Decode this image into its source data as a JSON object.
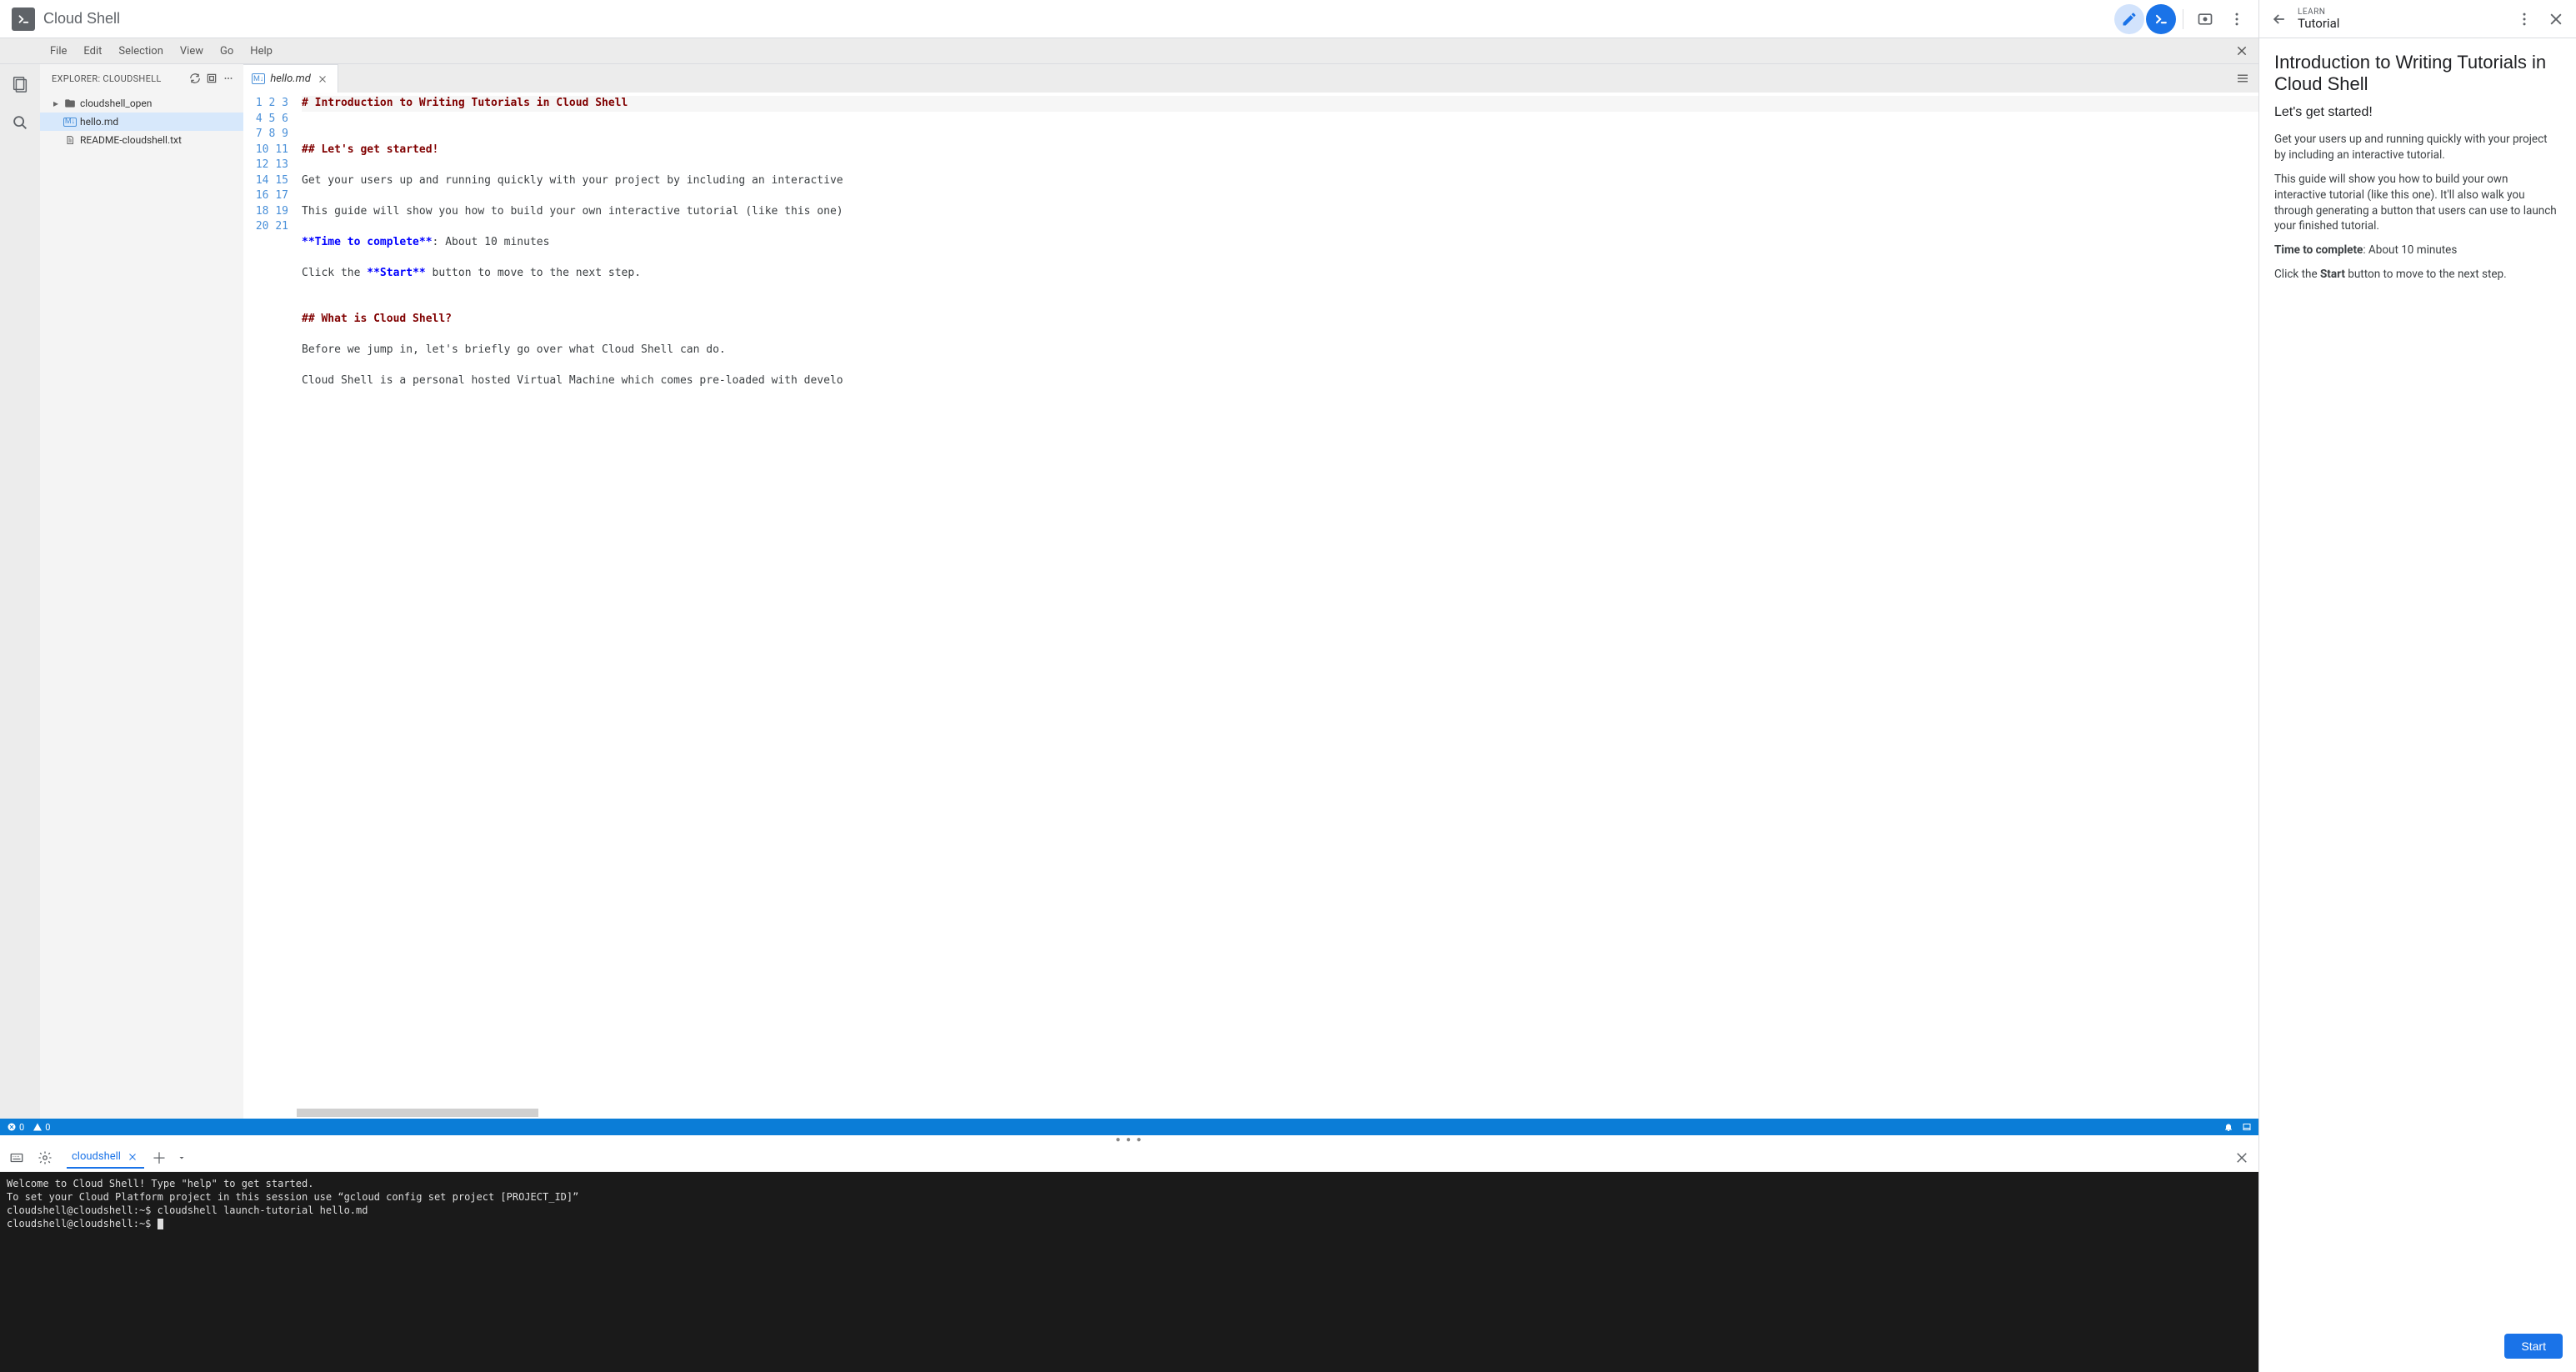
{
  "brand": "Cloud Shell",
  "menu": {
    "file": "File",
    "edit": "Edit",
    "selection": "Selection",
    "view": "View",
    "go": "Go",
    "help": "Help"
  },
  "explorer": {
    "title": "EXPLORER: CLOUDSHELL",
    "items": [
      {
        "name": "cloudshell_open",
        "type": "folder"
      },
      {
        "name": "hello.md",
        "type": "file",
        "selected": true
      },
      {
        "name": "README-cloudshell.txt",
        "type": "file"
      }
    ]
  },
  "editor_tab": {
    "label": "hello.md"
  },
  "code_lines": [
    {
      "tokens": [
        {
          "class": "tok-head",
          "text": "# Introduction to Writing Tutorials in Cloud Shell"
        }
      ],
      "hl": true
    },
    {
      "tokens": []
    },
    {
      "tokens": []
    },
    {
      "tokens": [
        {
          "class": "tok-head",
          "text": "## Let's get started!"
        }
      ]
    },
    {
      "tokens": []
    },
    {
      "tokens": [
        {
          "class": "",
          "text": "Get your users up and running quickly with your project by including an interactive"
        }
      ]
    },
    {
      "tokens": []
    },
    {
      "tokens": [
        {
          "class": "",
          "text": "This guide will show you how to build your own interactive tutorial (like this one)"
        }
      ]
    },
    {
      "tokens": []
    },
    {
      "tokens": [
        {
          "class": "tok-bold",
          "text": "**Time to complete**"
        },
        {
          "class": "",
          "text": ": About 10 minutes"
        }
      ]
    },
    {
      "tokens": []
    },
    {
      "tokens": [
        {
          "class": "",
          "text": "Click the "
        },
        {
          "class": "tok-bold",
          "text": "**Start**"
        },
        {
          "class": "",
          "text": " button to move to the next step."
        }
      ]
    },
    {
      "tokens": []
    },
    {
      "tokens": []
    },
    {
      "tokens": [
        {
          "class": "tok-head",
          "text": "## What is Cloud Shell?"
        }
      ]
    },
    {
      "tokens": []
    },
    {
      "tokens": [
        {
          "class": "",
          "text": "Before we jump in, let's briefly go over what Cloud Shell can do."
        }
      ]
    },
    {
      "tokens": []
    },
    {
      "tokens": [
        {
          "class": "",
          "text": "Cloud Shell is a personal hosted Virtual Machine which comes pre-loaded with develo"
        }
      ]
    },
    {
      "tokens": []
    }
  ],
  "statusbar": {
    "errors": "0",
    "warnings": "0"
  },
  "terminal_tab": "cloudshell",
  "terminal_lines": [
    "Welcome to Cloud Shell! Type \"help\" to get started.",
    "To set your Cloud Platform project in this session use “gcloud config set project [PROJECT_ID]”",
    "cloudshell@cloudshell:~$ cloudshell launch-tutorial hello.md",
    "cloudshell@cloudshell:~$ "
  ],
  "tutorial": {
    "eyebrow": "LEARN",
    "title": "Tutorial",
    "heading": "Introduction to Writing Tutorials in Cloud Shell",
    "subheading": "Let's get started!",
    "p1": "Get your users up and running quickly with your project by including an interactive tutorial.",
    "p2": "This guide will show you how to build your own interactive tutorial (like this one). It'll also walk you through generating a button that users can use to launch your finished tutorial.",
    "time_label": "Time to complete",
    "time_value": ": About 10 minutes",
    "click_prefix": "Click the ",
    "click_bold": "Start",
    "click_suffix": " button to move to the next step.",
    "start": "Start"
  }
}
